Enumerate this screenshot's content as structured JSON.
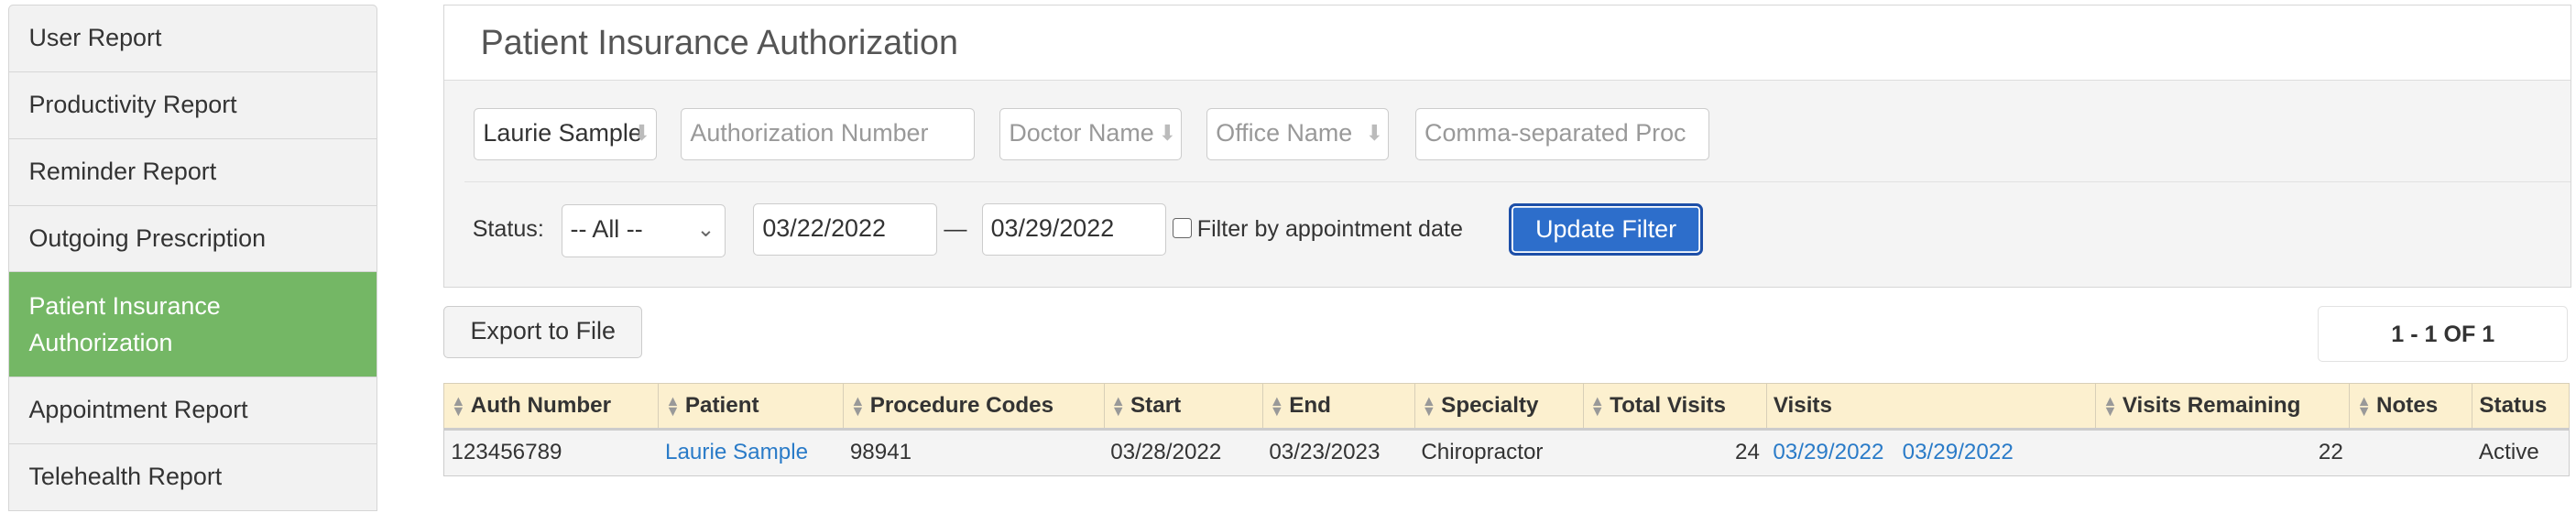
{
  "sidebar": {
    "items": [
      {
        "label": "User Report"
      },
      {
        "label": "Productivity Report"
      },
      {
        "label": "Reminder Report"
      },
      {
        "label": "Outgoing Prescription"
      },
      {
        "label": "Patient Insurance Authorization",
        "active": true
      },
      {
        "label": "Appointment Report"
      },
      {
        "label": "Telehealth Report"
      }
    ]
  },
  "panel": {
    "title": "Patient Insurance Authorization"
  },
  "filters": {
    "patient_value": "Laurie Sample",
    "auth_placeholder": "Authorization Number",
    "doctor_placeholder": "Doctor Name",
    "office_placeholder": "Office Name",
    "codes_placeholder": "Comma-separated Proc",
    "status_label": "Status:",
    "status_value": "-- All --",
    "date_from": "03/22/2022",
    "dash": "—",
    "date_to": "03/29/2022",
    "appt_checkbox_label": "Filter by appointment date",
    "appt_checked": false,
    "update_label": "Update Filter"
  },
  "export_label": "Export to File",
  "pagination": "1 - 1 OF 1",
  "table": {
    "columns": [
      "Auth Number",
      "Patient",
      "Procedure Codes",
      "Start",
      "End",
      "Specialty",
      "Total Visits",
      "Visits",
      "Visits Remaining",
      "Notes",
      "Status"
    ],
    "rows": [
      {
        "auth": "123456789",
        "patient": "Laurie Sample",
        "codes": "98941",
        "start": "03/28/2022",
        "end": "03/23/2023",
        "specialty": "Chiropractor",
        "total": "24",
        "visits": [
          "03/29/2022",
          "03/29/2022"
        ],
        "remaining": "22",
        "notes": "",
        "status": "Active"
      }
    ]
  },
  "colors": {
    "active": "#74b765",
    "primary": "#2d6ecb",
    "header": "#fcf0cf",
    "link": "#2a7bc8"
  }
}
